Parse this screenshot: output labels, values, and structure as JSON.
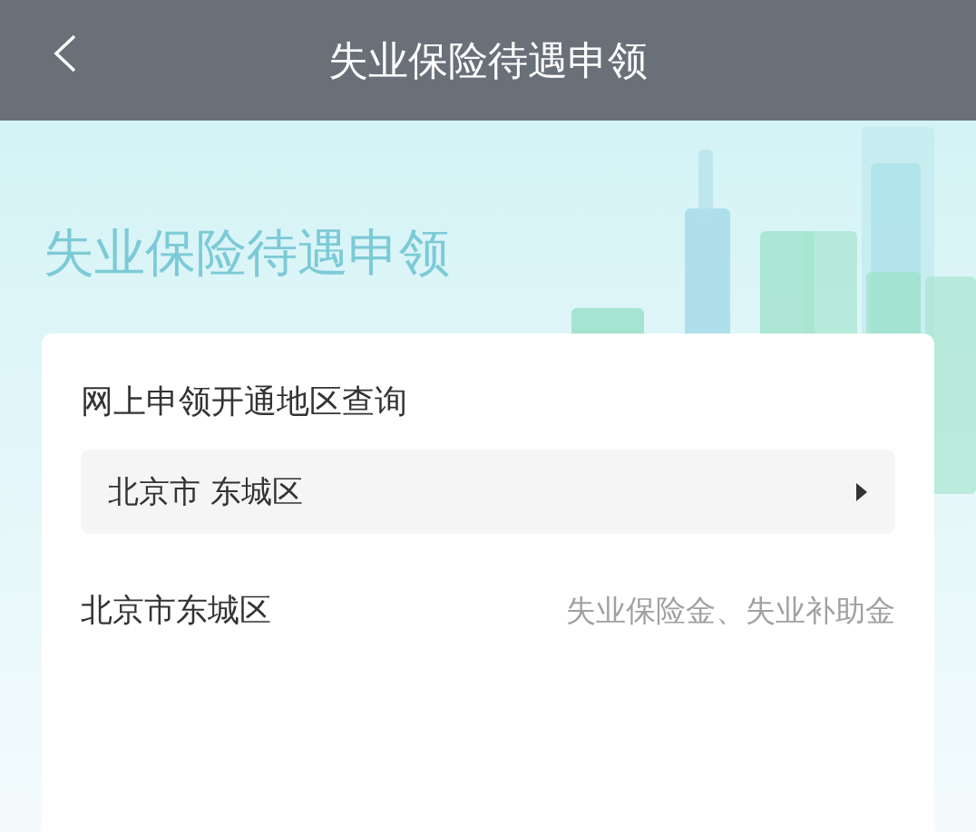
{
  "header": {
    "title": "失业保险待遇申领"
  },
  "banner": {
    "title": "失业保险待遇申领"
  },
  "card": {
    "title": "网上申领开通地区查询",
    "region_select": {
      "value": "北京市 东城区"
    },
    "results": [
      {
        "region": "北京市东城区",
        "benefits": "失业保险金、失业补助金"
      }
    ]
  }
}
